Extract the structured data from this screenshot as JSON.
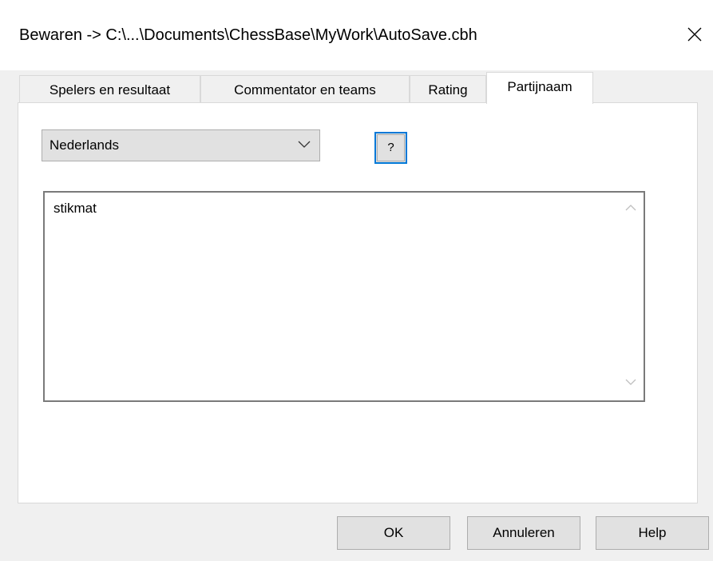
{
  "window": {
    "title": "Bewaren -> C:\\...\\Documents\\ChessBase\\MyWork\\AutoSave.cbh",
    "close_icon": "close-icon"
  },
  "tabs": [
    {
      "label": "Spelers en resultaat",
      "active": false
    },
    {
      "label": "Commentator en teams",
      "active": false
    },
    {
      "label": "Rating",
      "active": false
    },
    {
      "label": "Partijnaam",
      "active": true
    }
  ],
  "panel": {
    "language": {
      "selected": "Nederlands",
      "icon": "chevron-down-icon"
    },
    "help_question_label": "?",
    "game_name": {
      "value": "stikmat",
      "scroll_up_icon": "chevron-up-icon",
      "scroll_down_icon": "chevron-down-icon"
    }
  },
  "buttons": {
    "ok": "OK",
    "cancel": "Annuleren",
    "help": "Help"
  },
  "colors": {
    "focus_accent": "#0078d7",
    "button_face": "#e1e1e1",
    "dialog_background": "#f0f0f0"
  }
}
